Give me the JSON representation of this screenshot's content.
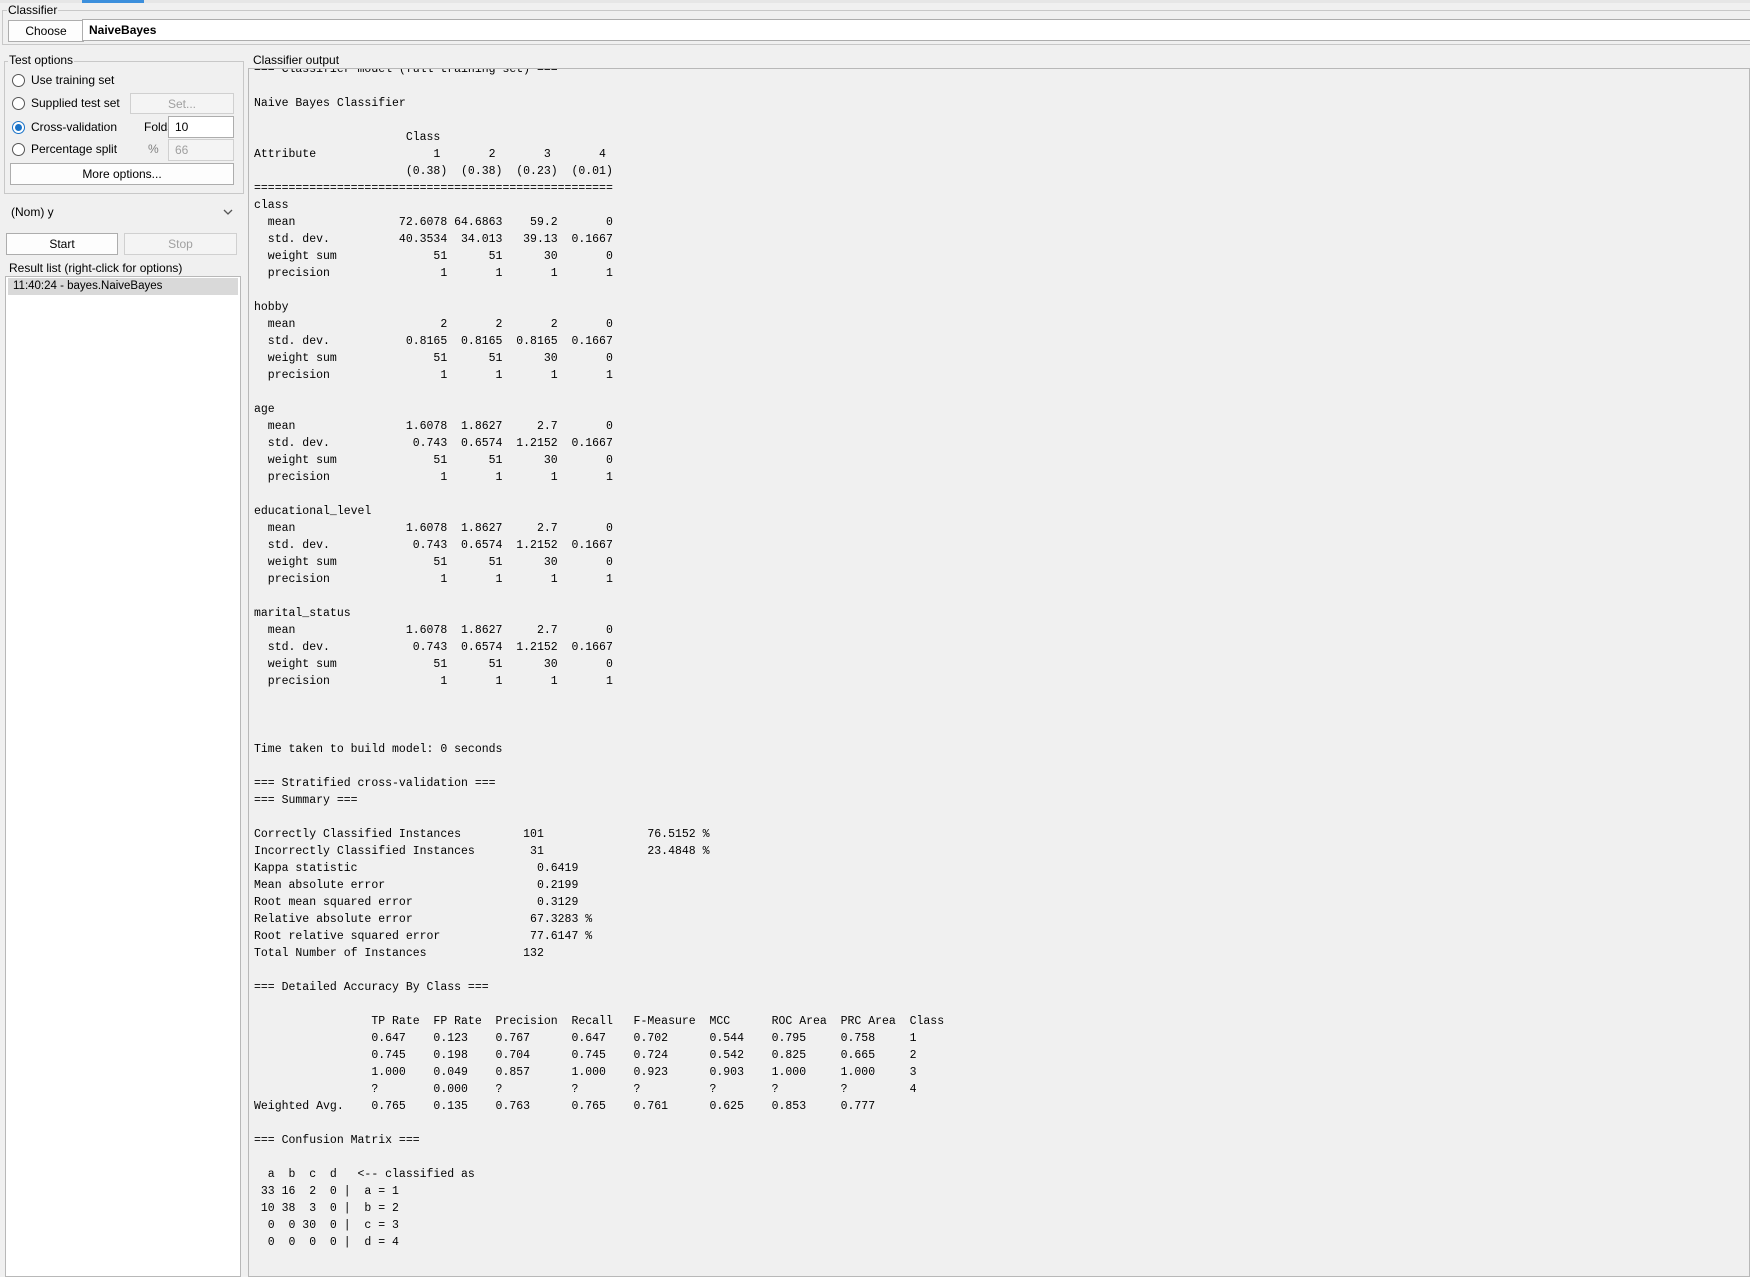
{
  "classifier": {
    "group_title": "Classifier",
    "choose_label": "Choose",
    "name": "NaiveBayes"
  },
  "test_options": {
    "group_title": "Test options",
    "use_training_set": "Use training set",
    "supplied_test_set": "Supplied test set",
    "set_button": "Set...",
    "cross_validation": "Cross-validation",
    "folds_label": "Folds",
    "folds_value": "10",
    "percentage_split": "Percentage split",
    "percent_symbol": "%",
    "percent_value": "66",
    "more_options": "More options...",
    "selected": "cross_validation"
  },
  "class_attribute": {
    "value": "(Nom) y"
  },
  "run": {
    "start_label": "Start",
    "stop_label": "Stop"
  },
  "result_list": {
    "title": "Result list (right-click for options)",
    "items": [
      "11:40:24 - bayes.NaiveBayes"
    ]
  },
  "output": {
    "title": "Classifier output",
    "text": "=== Classifier model (full training set) ===\n\nNaive Bayes Classifier\n\n                      Class\nAttribute                 1       2       3       4\n                      (0.38)  (0.38)  (0.23)  (0.01)\n====================================================\nclass\n  mean               72.6078 64.6863    59.2       0\n  std. dev.          40.3534  34.013   39.13  0.1667\n  weight sum              51      51      30       0\n  precision                1       1       1       1\n\nhobby\n  mean                     2       2       2       0\n  std. dev.           0.8165  0.8165  0.8165  0.1667\n  weight sum              51      51      30       0\n  precision                1       1       1       1\n\nage\n  mean                1.6078  1.8627     2.7       0\n  std. dev.            0.743  0.6574  1.2152  0.1667\n  weight sum              51      51      30       0\n  precision                1       1       1       1\n\neducational_level\n  mean                1.6078  1.8627     2.7       0\n  std. dev.            0.743  0.6574  1.2152  0.1667\n  weight sum              51      51      30       0\n  precision                1       1       1       1\n\nmarital_status\n  mean                1.6078  1.8627     2.7       0\n  std. dev.            0.743  0.6574  1.2152  0.1667\n  weight sum              51      51      30       0\n  precision                1       1       1       1\n\n\n\nTime taken to build model: 0 seconds\n\n=== Stratified cross-validation ===\n=== Summary ===\n\nCorrectly Classified Instances         101               76.5152 %\nIncorrectly Classified Instances        31               23.4848 %\nKappa statistic                          0.6419\nMean absolute error                      0.2199\nRoot mean squared error                  0.3129\nRelative absolute error                 67.3283 %\nRoot relative squared error             77.6147 %\nTotal Number of Instances              132     \n\n=== Detailed Accuracy By Class ===\n\n                 TP Rate  FP Rate  Precision  Recall   F-Measure  MCC      ROC Area  PRC Area  Class\n                 0.647    0.123    0.767      0.647    0.702      0.544    0.795     0.758     1\n                 0.745    0.198    0.704      0.745    0.724      0.542    0.825     0.665     2\n                 1.000    0.049    0.857      1.000    0.923      0.903    1.000     1.000     3\n                 ?        0.000    ?          ?        ?          ?        ?         ?         4\nWeighted Avg.    0.765    0.135    0.763      0.765    0.761      0.625    0.853     0.777     \n\n=== Confusion Matrix ===\n\n  a  b  c  d   <-- classified as\n 33 16  2  0 |  a = 1\n 10 38  3  0 |  b = 2\n  0  0 30  0 |  c = 3\n  0  0  0  0 |  d = 4"
  },
  "colors": {
    "accent": "#1a73c8",
    "tab_highlight": "#3c8fdc",
    "selection": "#d9d9d9"
  },
  "icons": {
    "dropdown": "chevron-down-icon"
  }
}
